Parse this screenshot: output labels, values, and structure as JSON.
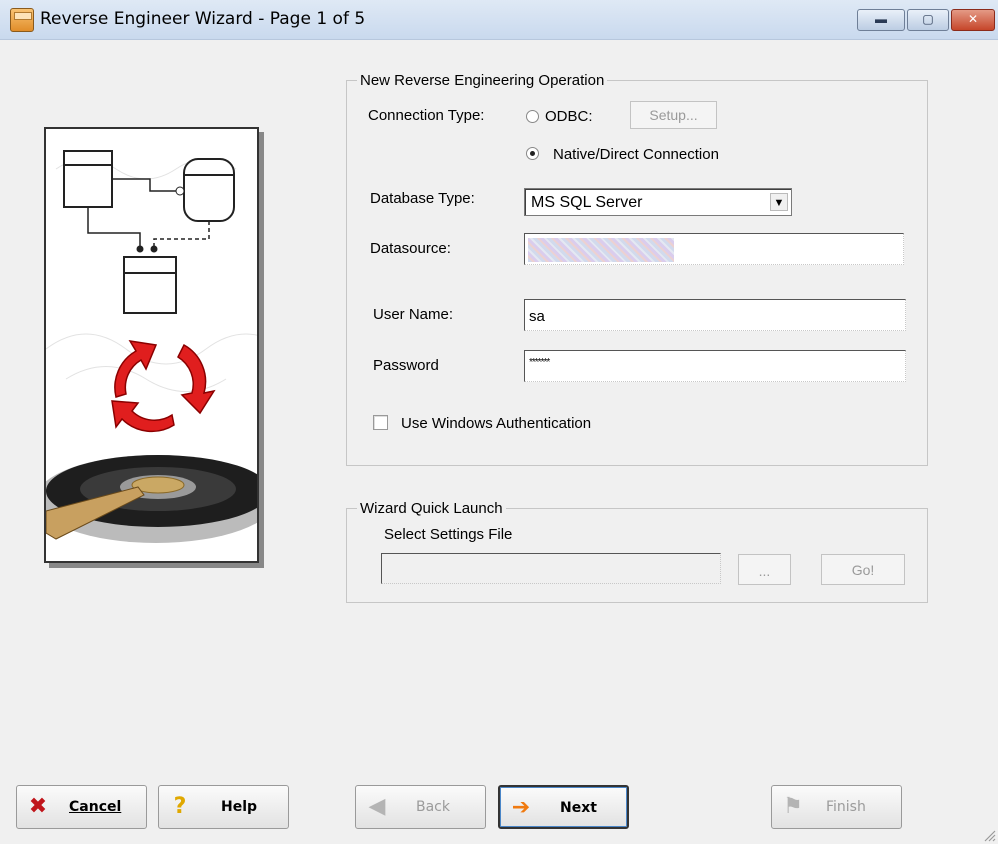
{
  "window": {
    "title": "Reverse Engineer Wizard - Page 1 of 5",
    "minimize_glyph": "▬",
    "maximize_glyph": "▢",
    "close_glyph": "✕"
  },
  "operation_group": {
    "legend": "New Reverse Engineering Operation",
    "connection_type_label": "Connection Type:",
    "odbc_label": "ODBC:",
    "odbc_selected": false,
    "setup_button": "Setup...",
    "native_label": "Native/Direct Connection",
    "native_selected": true,
    "database_type_label": "Database Type:",
    "database_type_value": "MS SQL Server",
    "datasource_label": "Datasource:",
    "user_name_label": "User Name:",
    "user_name_value": "sa",
    "password_label": "Password",
    "password_value": "*******",
    "windows_auth_label": "Use Windows Authentication",
    "windows_auth_checked": false
  },
  "quick_launch_group": {
    "legend": "Wizard Quick Launch",
    "settings_label": "Select Settings File",
    "settings_value": "",
    "browse_button": "...",
    "go_button": "Go!"
  },
  "buttons": {
    "cancel": "Cancel",
    "help": "Help",
    "back": "Back",
    "next": "Next",
    "finish": "Finish"
  },
  "icons": {
    "cancel": "close-x-icon",
    "help": "question-mark-icon",
    "back": "arrow-left-icon",
    "next": "arrow-right-icon",
    "finish": "checkered-flag-icon"
  },
  "colors": {
    "cancel_x": "#c0141a",
    "help_mark": "#e0a800",
    "next_arrow": "#f07a10",
    "cycle_arrows": "#e01e1e"
  }
}
